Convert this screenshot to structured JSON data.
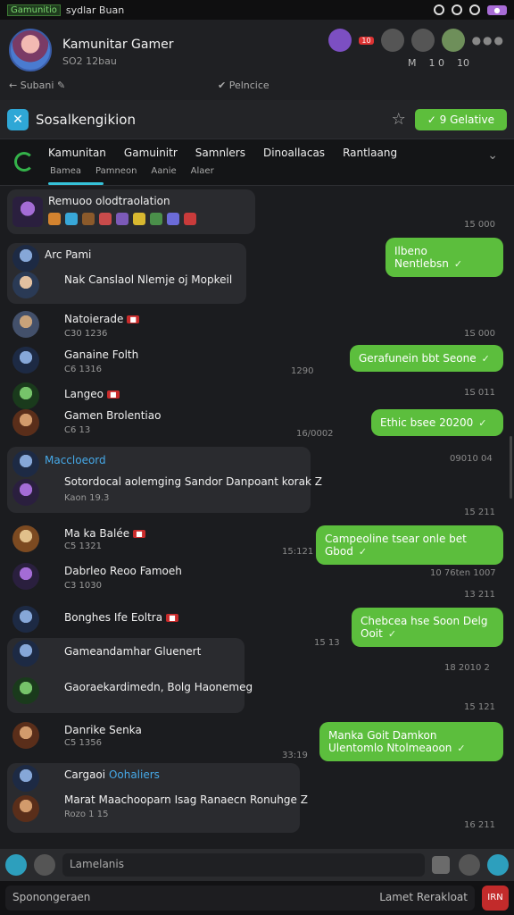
{
  "status_bar": {
    "app": "Gamunitio",
    "title": "sydlar Buan"
  },
  "header": {
    "title": "Kamunitar Gamer",
    "sub": "SO2 12bau",
    "back_label": "Subani",
    "center_label": "Pelncice",
    "badge": "10",
    "stats": [
      "M",
      "1  0",
      "10"
    ]
  },
  "group": {
    "title": "Sosalkengikion",
    "button": "9 Gelative"
  },
  "tabs": {
    "items": [
      "Kamunitan",
      "Gamuinitr",
      "Samnlers",
      "Dinoallacas",
      "Rantlaang"
    ],
    "subs": [
      "Bamea",
      "Pamneon",
      "Aanie",
      "Alaer"
    ]
  },
  "messages": [
    {
      "title": "Remuoo olodtraolation",
      "time": "15 000"
    },
    {
      "name": "Arc Pami",
      "text": "Nak Canslaol Nlemje oj Mopkeil",
      "time": "",
      "out": "Ilbeno Nentlebsn"
    },
    {
      "name": "Natoierade",
      "sub": "C30 1236",
      "time": "1S 000"
    },
    {
      "name": "Ganaine Folth",
      "sub": "C6 1316",
      "time": "1290",
      "out": "Gerafunein bbt Seone"
    },
    {
      "name": "Langeo",
      "time": "1S 011"
    },
    {
      "name": "Gamen Brolentiao",
      "sub": "C6 13",
      "time": "16/0002",
      "out": "Ethic bsee  20200"
    },
    {
      "name": "Maccloeord",
      "time": "09010 04",
      "text": "Sotordocal aolemging Sandor Danpoant korak Z",
      "sub": "Kaon 19.3",
      "time2": "15 211"
    },
    {
      "name": "Ma ka Balée",
      "sub": "C5 1321",
      "time": "15:121",
      "out": "Campeoline tsear onle bet Gbod"
    },
    {
      "name": "Dabrleo Reoo Famoeh",
      "sub": "C3 1030",
      "time": "10 76ten  1007",
      "time2": "13 211"
    },
    {
      "name": "Bonghes Ife Eoltra",
      "time": "15 13",
      "out": "Chebcea hse Soon Delg Ooit"
    },
    {
      "name": "Gameandamhar Gluenert",
      "text": "Gaoraekardimedn, Bolg Haonemeg",
      "time": "18 2010  2",
      "time2": "15 121"
    },
    {
      "name": "Danrike Senka",
      "sub": "C5 1356",
      "time": "33:19",
      "out": "Manka Goit Damkon Ulentomlo Ntolmeaoon"
    },
    {
      "name": "Cargaoi",
      "tag": "Oohaliers",
      "text": "Marat Maachooparn Isag Ranaecn Ronuhge Z",
      "sub": "Rozo 1 15",
      "time": "16 211"
    }
  ],
  "composer": {
    "placeholder": "Lamelanis"
  },
  "bottom": {
    "left": "Sponongeraen",
    "right": "Lamet Rerakloat",
    "send": "IRN"
  },
  "colors": {
    "accent": "#5cbe3d",
    "tab_underline": "#36c2d9"
  }
}
